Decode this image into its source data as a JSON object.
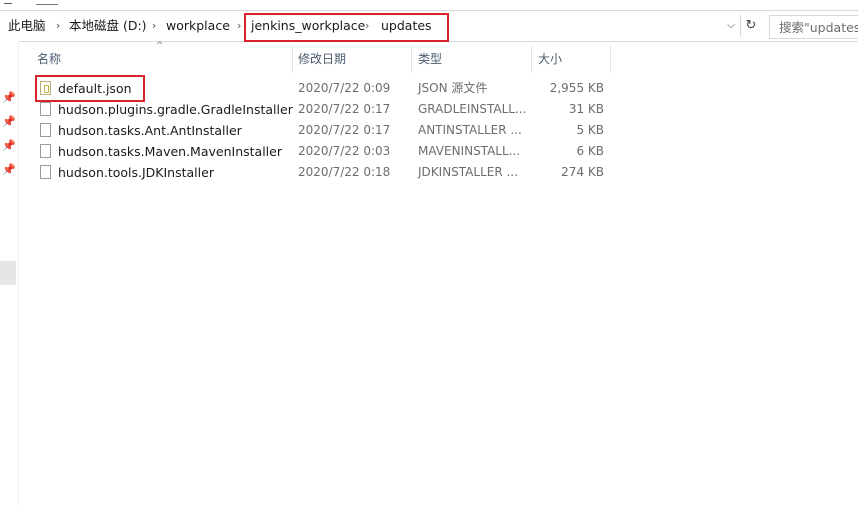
{
  "breadcrumb": {
    "items": [
      {
        "label": "此电脑"
      },
      {
        "label": "本地磁盘 (D:)"
      },
      {
        "label": "workplace"
      },
      {
        "label": "jenkins_workplace"
      },
      {
        "label": "updates"
      }
    ],
    "separator": "›"
  },
  "address_controls": {
    "dropdown": "⌵",
    "refresh": "↻"
  },
  "search": {
    "placeholder": "搜索\"updates\""
  },
  "sort_indicator": "^",
  "columns": {
    "name": "名称",
    "date": "修改日期",
    "type": "类型",
    "size": "大小"
  },
  "files": [
    {
      "name": "default.json",
      "date": "2020/7/22 0:09",
      "type": "JSON 源文件",
      "size": "2,955 KB",
      "icon": "json-file-icon"
    },
    {
      "name": "hudson.plugins.gradle.GradleInstaller",
      "date": "2020/7/22 0:17",
      "type": "GRADLEINSTALL...",
      "size": "31 KB",
      "icon": "file-icon"
    },
    {
      "name": "hudson.tasks.Ant.AntInstaller",
      "date": "2020/7/22 0:17",
      "type": "ANTINSTALLER ...",
      "size": "5 KB",
      "icon": "file-icon"
    },
    {
      "name": "hudson.tasks.Maven.MavenInstaller",
      "date": "2020/7/22 0:03",
      "type": "MAVENINSTALL...",
      "size": "6 KB",
      "icon": "file-icon"
    },
    {
      "name": "hudson.tools.JDKInstaller",
      "date": "2020/7/22 0:18",
      "type": "JDKINSTALLER ...",
      "size": "274 KB",
      "icon": "file-icon"
    }
  ],
  "colors": {
    "highlight": "#d8232a",
    "header_text": "#4b5b6f",
    "meta_text": "#6d6d6d"
  }
}
